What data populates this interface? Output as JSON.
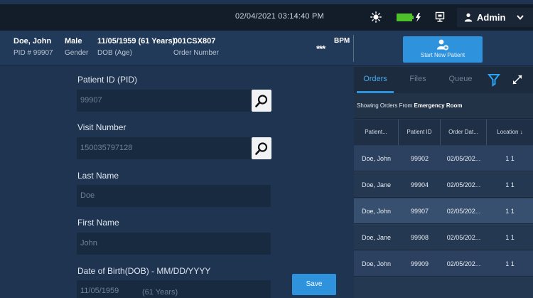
{
  "topbar": {
    "datetime": "02/04/2021 03:14:40 PM",
    "user_name": "Admin",
    "icons": {
      "brightness": "sun-icon",
      "battery": "battery-charging-icon",
      "display": "monitor-icon",
      "user": "user-icon",
      "menu": "chevron-down-icon"
    },
    "battery_color": "#4fc12a"
  },
  "patient_header": {
    "name": "Doe, John",
    "pid": "PID # 99907",
    "gender": "Male",
    "gender_label": "Gender",
    "dob": "11/05/1959 (61 Years)",
    "dob_label": "DOB (Age)",
    "order_number": "001CSX807",
    "order_number_label": "Order Number",
    "bpm_value": "***",
    "bpm_label": "BPM"
  },
  "start_patient": {
    "label": "Start New Patient",
    "icon": "add-user-icon"
  },
  "form": {
    "fields": [
      {
        "label": "Patient ID (PID)",
        "value": "99907"
      },
      {
        "label": "Visit Number",
        "value": "150035797128"
      },
      {
        "label": "Last Name",
        "value": "Doe"
      },
      {
        "label": "First Name",
        "value": "John"
      },
      {
        "label": "Date of Birth(DOB) - MM/DD/YYYY",
        "value": "11/05/1959",
        "age": "(61 Years)"
      }
    ],
    "save_label": "Save",
    "search_icon": "search-icon"
  },
  "orders_panel": {
    "tabs": [
      "Orders",
      "Files",
      "Queue"
    ],
    "active_tab": "Orders",
    "filter_icon": "filter-icon",
    "expand_icon": "expand-icon",
    "filter_color": "#2aa4f4",
    "showing_prefix": "Showing Orders From",
    "showing_location": "Emergency Room",
    "columns": [
      "Patient...",
      "Patient ID",
      "Order Dat...",
      "Location"
    ],
    "sort_icon": "sort-down-icon",
    "rows": [
      {
        "patient": "Doe, John",
        "patient_id": "99902",
        "order_date": "02/05/202...",
        "location": "1 1"
      },
      {
        "patient": "Doe, Jane",
        "patient_id": "99904",
        "order_date": "02/05/202...",
        "location": "1 1"
      },
      {
        "patient": "Doe, John",
        "patient_id": "99907",
        "order_date": "02/05/202...",
        "location": "1 1"
      },
      {
        "patient": "Doe, Jane",
        "patient_id": "99908",
        "order_date": "02/05/202...",
        "location": "1 1"
      },
      {
        "patient": "Doe, John",
        "patient_id": "99909",
        "order_date": "02/05/202...",
        "location": "1 1"
      }
    ],
    "selected_row_index": 2
  }
}
